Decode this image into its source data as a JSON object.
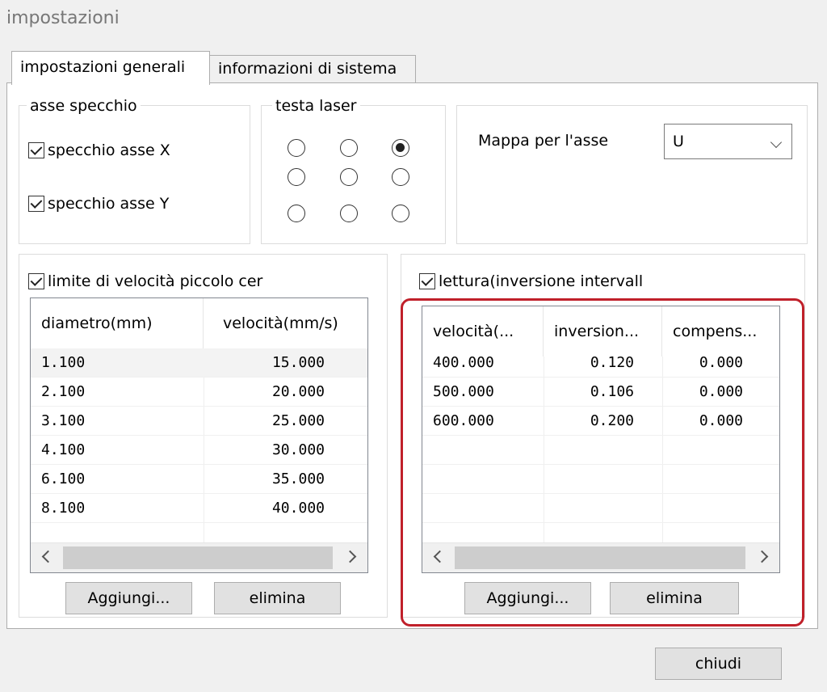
{
  "window": {
    "title": "impostazioni"
  },
  "tabs": [
    {
      "label": "impostazioni generali",
      "active": true
    },
    {
      "label": "informazioni di sistema",
      "active": false
    }
  ],
  "mirror_axis": {
    "legend": "asse specchio",
    "x_label": "specchio asse X",
    "x_checked": true,
    "y_label": "specchio asse Y",
    "y_checked": true
  },
  "laser_head": {
    "legend": "testa laser",
    "selected_index": 2
  },
  "axis_map": {
    "label": "Mappa per l'asse",
    "value": "U"
  },
  "speed_limit": {
    "checkbox_label": "limite di velocità piccolo cer",
    "checked": true,
    "columns": [
      "diametro(mm)",
      "velocità(mm/s)"
    ],
    "rows": [
      [
        "1.100",
        "15.000"
      ],
      [
        "2.100",
        "20.000"
      ],
      [
        "3.100",
        "25.000"
      ],
      [
        "4.100",
        "30.000"
      ],
      [
        "6.100",
        "35.000"
      ],
      [
        "8.100",
        "40.000"
      ]
    ],
    "add_label": "Aggiungi...",
    "delete_label": "elimina"
  },
  "reversal": {
    "checkbox_label": "lettura(inversione intervall",
    "checked": true,
    "columns": [
      "velocità(...",
      "inversion...",
      "compens..."
    ],
    "rows": [
      [
        "400.000",
        "0.120",
        "0.000"
      ],
      [
        "500.000",
        "0.106",
        "0.000"
      ],
      [
        "600.000",
        "0.200",
        "0.000"
      ]
    ],
    "add_label": "Aggiungi...",
    "delete_label": "elimina"
  },
  "close_label": "chiudi",
  "colors": {
    "highlight": "#c0202a",
    "panel": "#ffffff",
    "background": "#f0f0f0"
  }
}
